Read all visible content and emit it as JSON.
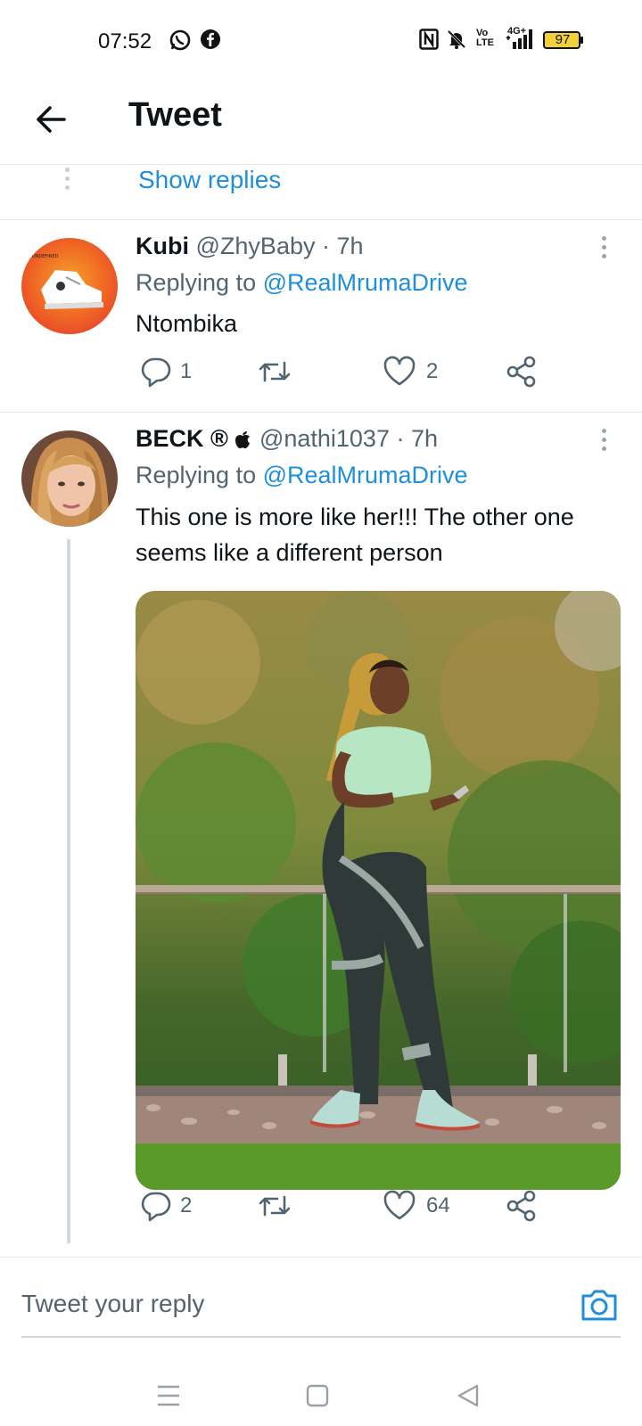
{
  "status_bar": {
    "time": "07:52",
    "icons": [
      "whatsapp-icon",
      "facebook-icon",
      "nfc-icon",
      "mute-icon",
      "volte-icon",
      "signal-icon"
    ],
    "network": "4G+",
    "volte_top": "Vo",
    "volte_bottom": "LTE",
    "battery": "97"
  },
  "header": {
    "back_icon": "arrow-left-icon",
    "title": "Tweet"
  },
  "thread": {
    "show_replies": "Show replies"
  },
  "tweets": [
    {
      "name": "Kubi",
      "handle": "@ZhyBaby",
      "time": "· 7h",
      "replying_prefix": "Replying to",
      "replying_to": "@RealMrumaDrive",
      "text": "Ntombika",
      "avatar_text": "UNDEFINED",
      "actions": {
        "reply_count": "1",
        "retweet_count": "",
        "like_count": "2"
      }
    },
    {
      "name": "BECK ®",
      "handle": "@nathi1037",
      "time": "· 7h",
      "replying_prefix": "Replying to",
      "replying_to": "@RealMrumaDrive",
      "text": "This one is more like her!!! The other one seems like a different person",
      "actions": {
        "reply_count": "2",
        "retweet_count": "",
        "like_count": "64"
      }
    }
  ],
  "reply_bar": {
    "placeholder": "Tweet your reply",
    "camera_icon": "camera-icon"
  },
  "nav_bar": {
    "icons": [
      "menu-icon",
      "home-square-icon",
      "back-triangle-icon"
    ]
  },
  "colors": {
    "accent": "#1f8fd8",
    "text": "#0f1419",
    "secondary": "#536471",
    "battery_fill": "#f2d03b"
  }
}
